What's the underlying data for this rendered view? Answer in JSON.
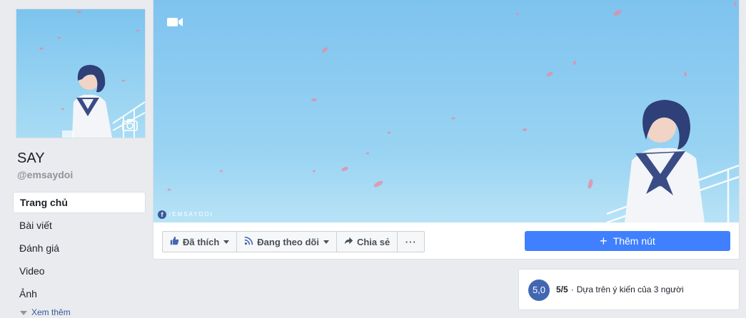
{
  "page": {
    "name": "SAY",
    "handle": "@emsaydoi",
    "watermark": "/EMSAYDOI",
    "watermark_icon": "f"
  },
  "nav": {
    "items": [
      {
        "label": "Trang chủ",
        "active": true
      },
      {
        "label": "Bài viết"
      },
      {
        "label": "Đánh giá"
      },
      {
        "label": "Video"
      },
      {
        "label": "Ảnh"
      }
    ],
    "see_more": "Xem thêm"
  },
  "actions": {
    "liked": "Đã thích",
    "following": "Đang theo dõi",
    "share": "Chia sẻ",
    "more": "···",
    "add_button": "Thêm nút",
    "add_plus": "+"
  },
  "rating": {
    "badge": "5,0",
    "score": "5/5",
    "separator": "·",
    "text": "Dựa trên ý kiến của 3 người"
  },
  "colors": {
    "accent": "#4080ff",
    "brand": "#4267b2",
    "sky": "#8fd0f0",
    "background": "#e9ebee"
  },
  "icons": {
    "camera": "camera-icon",
    "video": "video-camera-icon",
    "like": "thumbs-up-icon",
    "follow": "rss-icon",
    "share": "share-arrow-icon"
  }
}
